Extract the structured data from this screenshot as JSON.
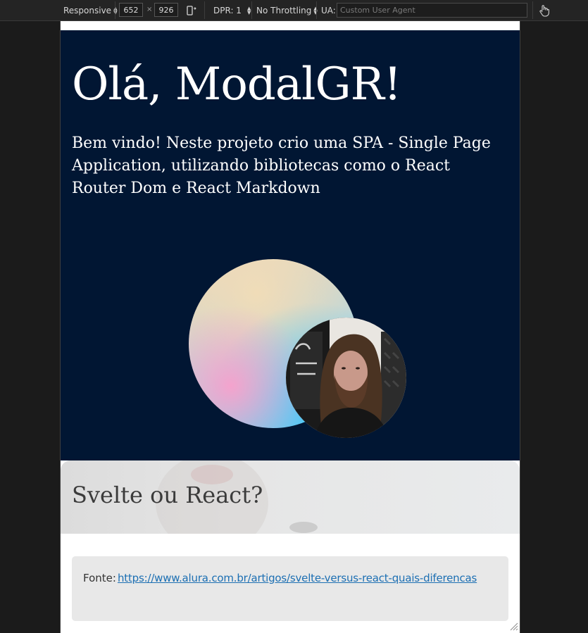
{
  "toolbar": {
    "device_mode": "Responsive",
    "width": "652",
    "height": "926",
    "times": "×",
    "dpr": "DPR: 1",
    "throttling": "No Throttling",
    "ua_label": "UA:",
    "ua_placeholder": "Custom User Agent"
  },
  "hero": {
    "title": "Olá, ModalGR!",
    "description": "Bem vindo! Neste projeto crio uma SPA - Single Page Application, utilizando bibliotecas como o React Router Dom e React Markdown"
  },
  "post": {
    "title": "Svelte ou React?"
  },
  "source": {
    "label": "Fonte:",
    "link": "https://www.alura.com.br/artigos/svelte-versus-react-quais-diferencas"
  },
  "colors": {
    "hero_background": "#011633",
    "link": "#1c6fb3",
    "devtools_background": "#242424"
  }
}
